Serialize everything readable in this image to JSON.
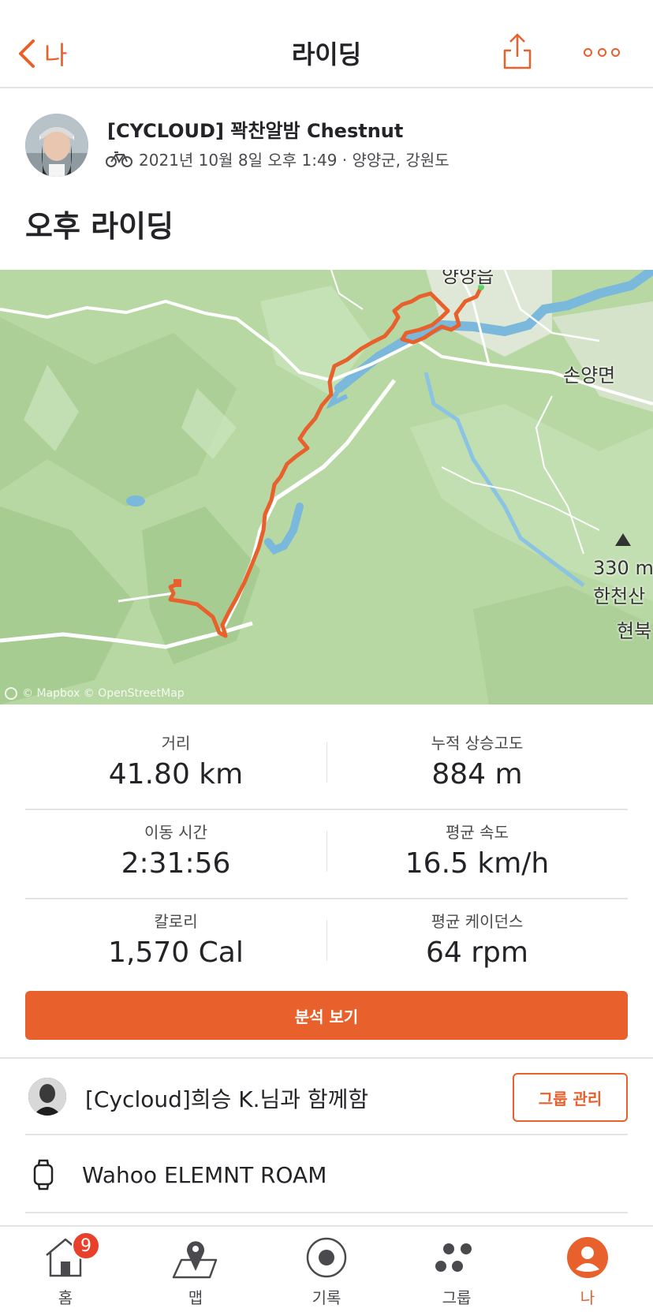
{
  "nav": {
    "back_label": "나",
    "title": "라이딩"
  },
  "header": {
    "athlete_name": "[CYCLOUD] 꽉찬알밤 Chestnut",
    "meta": "2021년 10월 8일 오후 1:49 · 양양군, 강원도",
    "activity_title": "오후 라이딩"
  },
  "map": {
    "labels": {
      "town_top": "양양읍",
      "town_right": "손양면",
      "peak_elev": "330 m",
      "peak_name": "한천산",
      "partial_right": "현북"
    },
    "attribution": "© Mapbox © OpenStreetMap",
    "route_color": "#e8602b"
  },
  "stats": [
    [
      {
        "label": "거리",
        "value": "41.80 km"
      },
      {
        "label": "누적 상승고도",
        "value": "884 m"
      }
    ],
    [
      {
        "label": "이동 시간",
        "value": "2:31:56"
      },
      {
        "label": "평균 속도",
        "value": "16.5 km/h"
      }
    ],
    [
      {
        "label": "칼로리",
        "value": "1,570 Cal"
      },
      {
        "label": "평균 케이던스",
        "value": "64 rpm"
      }
    ]
  ],
  "analysis_button": "분석 보기",
  "group": {
    "text": "[Cycloud]희승 K.님과 함께함",
    "button": "그룹 관리"
  },
  "device": {
    "name": "Wahoo ELEMNT ROAM"
  },
  "tabbar": {
    "home": "홈",
    "home_badge": "9",
    "maps": "맵",
    "record": "기록",
    "groups": "그룹",
    "you": "나"
  },
  "colors": {
    "accent": "#e8602b",
    "badge": "#e8402b"
  }
}
